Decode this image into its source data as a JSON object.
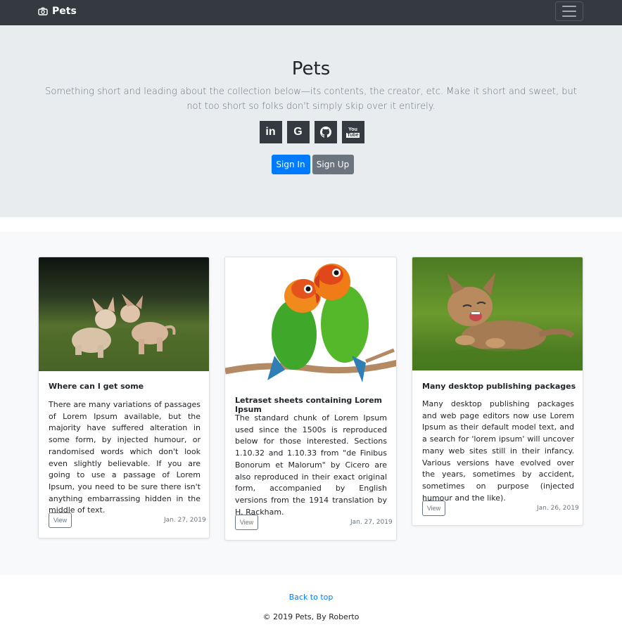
{
  "navbar": {
    "brand": "Pets",
    "brand_icon": "camera-icon",
    "menu_icon": "hamburger-icon"
  },
  "hero": {
    "title": "Pets",
    "lead": "Something short and leading about the collection below—its contents, the creator, etc. Make it short and sweet, but not too short so folks don't simply skip over it entirely.",
    "socials": [
      {
        "icon": "linkedin-icon",
        "glyph": "in"
      },
      {
        "icon": "google-icon",
        "glyph": "G"
      },
      {
        "icon": "github-icon",
        "glyph": ""
      },
      {
        "icon": "youtube-icon",
        "glyph": "You\nTube"
      }
    ],
    "sign_in": "Sign In",
    "sign_up": "Sign Up"
  },
  "cards": [
    {
      "image": "two puppies kissing on grass",
      "title": "Where can I get some",
      "text": "There are many variations of passages of Lorem Ipsum available, but the majority have suffered alteration in some form, by injected humour, or randomised words which don't look even slightly believable. If you are going to use a passage of Lorem Ipsum, you need to be sure there isn't anything embarrassing hidden in the middle of text.",
      "button": "View",
      "date": "Jan. 27, 2019"
    },
    {
      "image": "two lovebirds on a branch",
      "title": "Letraset sheets containing Lorem Ipsum",
      "text": "The standard chunk of Lorem Ipsum used since the 1500s is reproduced below for those interested. Sections 1.10.32 and 1.10.33 from \"de Finibus Bonorum et Malorum\" by Cicero are also reproduced in their exact original form, accompanied by English versions from the 1914 translation by H. Rackham.",
      "button": "View",
      "date": "Jan. 27, 2019"
    },
    {
      "image": "kitten laughing on grass",
      "title": "Many desktop publishing packages",
      "text": "Many desktop publishing packages and web page editors now use Lorem Ipsum as their default model text, and a search for 'lorem ipsum' will uncover many web sites still in their infancy. Various versions have evolved over the years, sometimes by accident, sometimes on purpose (injected humour and the like).",
      "button": "View",
      "date": "Jan. 26, 2019"
    }
  ],
  "footer": {
    "back_to_top": "Back to top",
    "copyright": "© 2019 Pets, By Roberto"
  },
  "colors": {
    "navbar": "#343a40",
    "hero_bg": "#e9ecef",
    "primary": "#007bff",
    "secondary": "#6c757d"
  }
}
